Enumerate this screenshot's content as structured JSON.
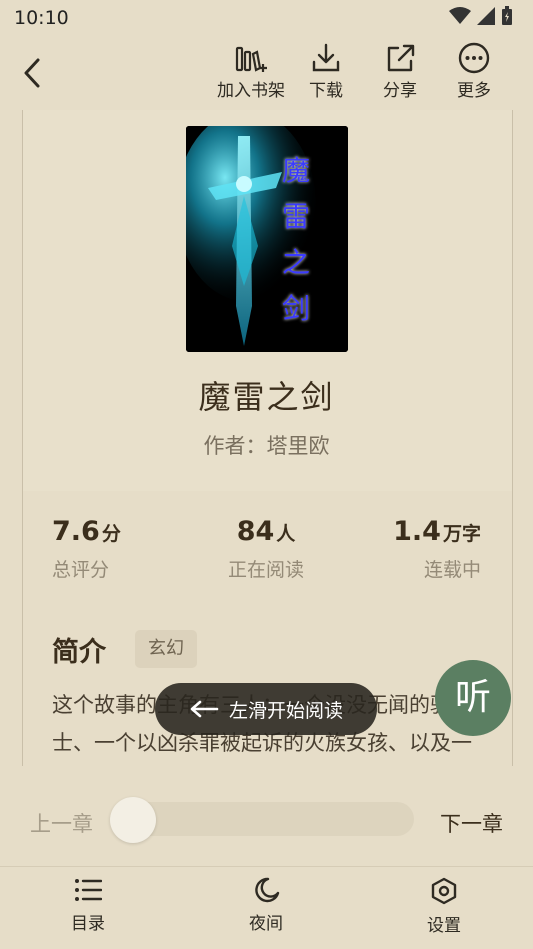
{
  "status_bar": {
    "time": "10:10"
  },
  "top_actions": {
    "add_shelf": "加入书架",
    "download": "下载",
    "share": "分享",
    "more": "更多"
  },
  "book": {
    "title": "魔雷之剑",
    "author": "作者：塔里欧",
    "cover_text": "魔雷之剑"
  },
  "stats": [
    {
      "value": "7.6",
      "unit": "分",
      "label": "总评分"
    },
    {
      "value": "84",
      "unit": "人",
      "label": "正在阅读"
    },
    {
      "value": "1.4",
      "unit": "万字",
      "label": "连载中"
    }
  ],
  "intro": {
    "title": "简介",
    "tag": "玄幻",
    "text": "这个故事的主角有三人：一个没没无闻的骑士、一个以凶杀罪被起诉的火族女孩、以及一名追求真相的年轻仕绅"
  },
  "listen_button": "听",
  "toast": "左滑开始阅读",
  "chapter_nav": {
    "prev": "上一章",
    "next": "下一章",
    "progress": 0
  },
  "bottom_nav": {
    "toc": "目录",
    "night": "夜间",
    "settings": "设置"
  },
  "colors": {
    "background": "#e6ddc8",
    "listen": "#5b7f62",
    "accent_text": "#3b2e1c"
  }
}
